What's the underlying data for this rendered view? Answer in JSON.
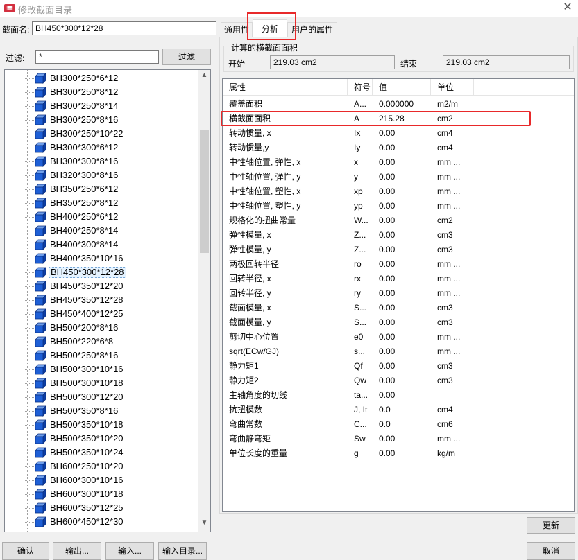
{
  "window": {
    "title": "修改截面目录",
    "close_glyph": "✕"
  },
  "left": {
    "name_label": "截面名:",
    "name_value": "BH450*300*12*28",
    "filter_label": "过滤:",
    "filter_value": "*",
    "filter_button": "过滤",
    "tree_items": [
      "BH300*250*6*12",
      "BH300*250*8*12",
      "BH300*250*8*14",
      "BH300*250*8*16",
      "BH300*250*10*22",
      "BH300*300*6*12",
      "BH300*300*8*16",
      "BH320*300*8*16",
      "BH350*250*6*12",
      "BH350*250*8*12",
      "BH400*250*6*12",
      "BH400*250*8*14",
      "BH400*300*8*14",
      "BH400*350*10*16",
      "BH450*300*12*28",
      "BH450*350*12*20",
      "BH450*350*12*28",
      "BH450*400*12*25",
      "BH500*200*8*16",
      "BH500*220*6*8",
      "BH500*250*8*16",
      "BH500*300*10*16",
      "BH500*300*10*18",
      "BH500*300*12*20",
      "BH500*350*8*16",
      "BH500*350*10*18",
      "BH500*350*10*20",
      "BH500*350*10*24",
      "BH600*250*10*20",
      "BH600*300*10*16",
      "BH600*300*10*18",
      "BH600*350*12*25",
      "BH600*450*12*30"
    ],
    "selected_item": "BH450*300*12*28"
  },
  "tabs": [
    "通用性",
    "分析",
    "用户的属性"
  ],
  "active_tab": "分析",
  "computed": {
    "group_title": "计算的横截面面积",
    "start_label": "开始",
    "start_value": "219.03 cm2",
    "end_label": "结束",
    "end_value": "219.03 cm2"
  },
  "table": {
    "headers": [
      "属性",
      "符号",
      "值",
      "单位"
    ],
    "rows": [
      [
        "覆盖面积",
        "A...",
        "0.000000",
        "m2/m"
      ],
      [
        "横截面面积",
        "A",
        "215.28",
        "cm2"
      ],
      [
        "转动惯量, x",
        "Ix",
        "0.00",
        "cm4"
      ],
      [
        "转动惯量,y",
        "Iy",
        "0.00",
        "cm4"
      ],
      [
        "中性轴位置, 弹性, x",
        "x",
        "0.00",
        "mm ..."
      ],
      [
        "中性轴位置, 弹性, y",
        "y",
        "0.00",
        "mm ..."
      ],
      [
        "中性轴位置, 塑性, x",
        "xp",
        "0.00",
        "mm ..."
      ],
      [
        "中性轴位置, 塑性, y",
        "yp",
        "0.00",
        "mm ..."
      ],
      [
        "规格化的扭曲常量",
        "W...",
        "0.00",
        "cm2"
      ],
      [
        "弹性模量, x",
        "Z...",
        "0.00",
        "cm3"
      ],
      [
        "弹性模量, y",
        "Z...",
        "0.00",
        "cm3"
      ],
      [
        "两极回转半径",
        "ro",
        "0.00",
        "mm ..."
      ],
      [
        "回转半径, x",
        "rx",
        "0.00",
        "mm ..."
      ],
      [
        "回转半径, y",
        "ry",
        "0.00",
        "mm ..."
      ],
      [
        "截面模量, x",
        "S...",
        "0.00",
        "cm3"
      ],
      [
        "截面模量, y",
        "S...",
        "0.00",
        "cm3"
      ],
      [
        "剪切中心位置",
        "e0",
        "0.00",
        "mm ..."
      ],
      [
        "sqrt(ECw/GJ)",
        "s...",
        "0.00",
        "mm ..."
      ],
      [
        "静力矩1",
        "Qf",
        "0.00",
        "cm3"
      ],
      [
        "静力矩2",
        "Qw",
        "0.00",
        "cm3"
      ],
      [
        "主轴角度的切线",
        "ta...",
        "0.00",
        ""
      ],
      [
        "抗扭模数",
        "J, It",
        "0.0",
        "cm4"
      ],
      [
        "弯曲常数",
        "C...",
        "0.0",
        "cm6"
      ],
      [
        "弯曲静弯矩",
        "Sw",
        "0.00",
        "mm ..."
      ],
      [
        "单位长度的重量",
        "g",
        "0.00",
        "kg/m"
      ]
    ]
  },
  "buttons": {
    "update": "更新",
    "confirm": "确认",
    "export": "输出...",
    "import": "输入...",
    "import_catalog": "输入目录...",
    "cancel": "取消"
  },
  "colors": {
    "highlight": "#e8292a",
    "cube_face": "#1e5fd6"
  }
}
